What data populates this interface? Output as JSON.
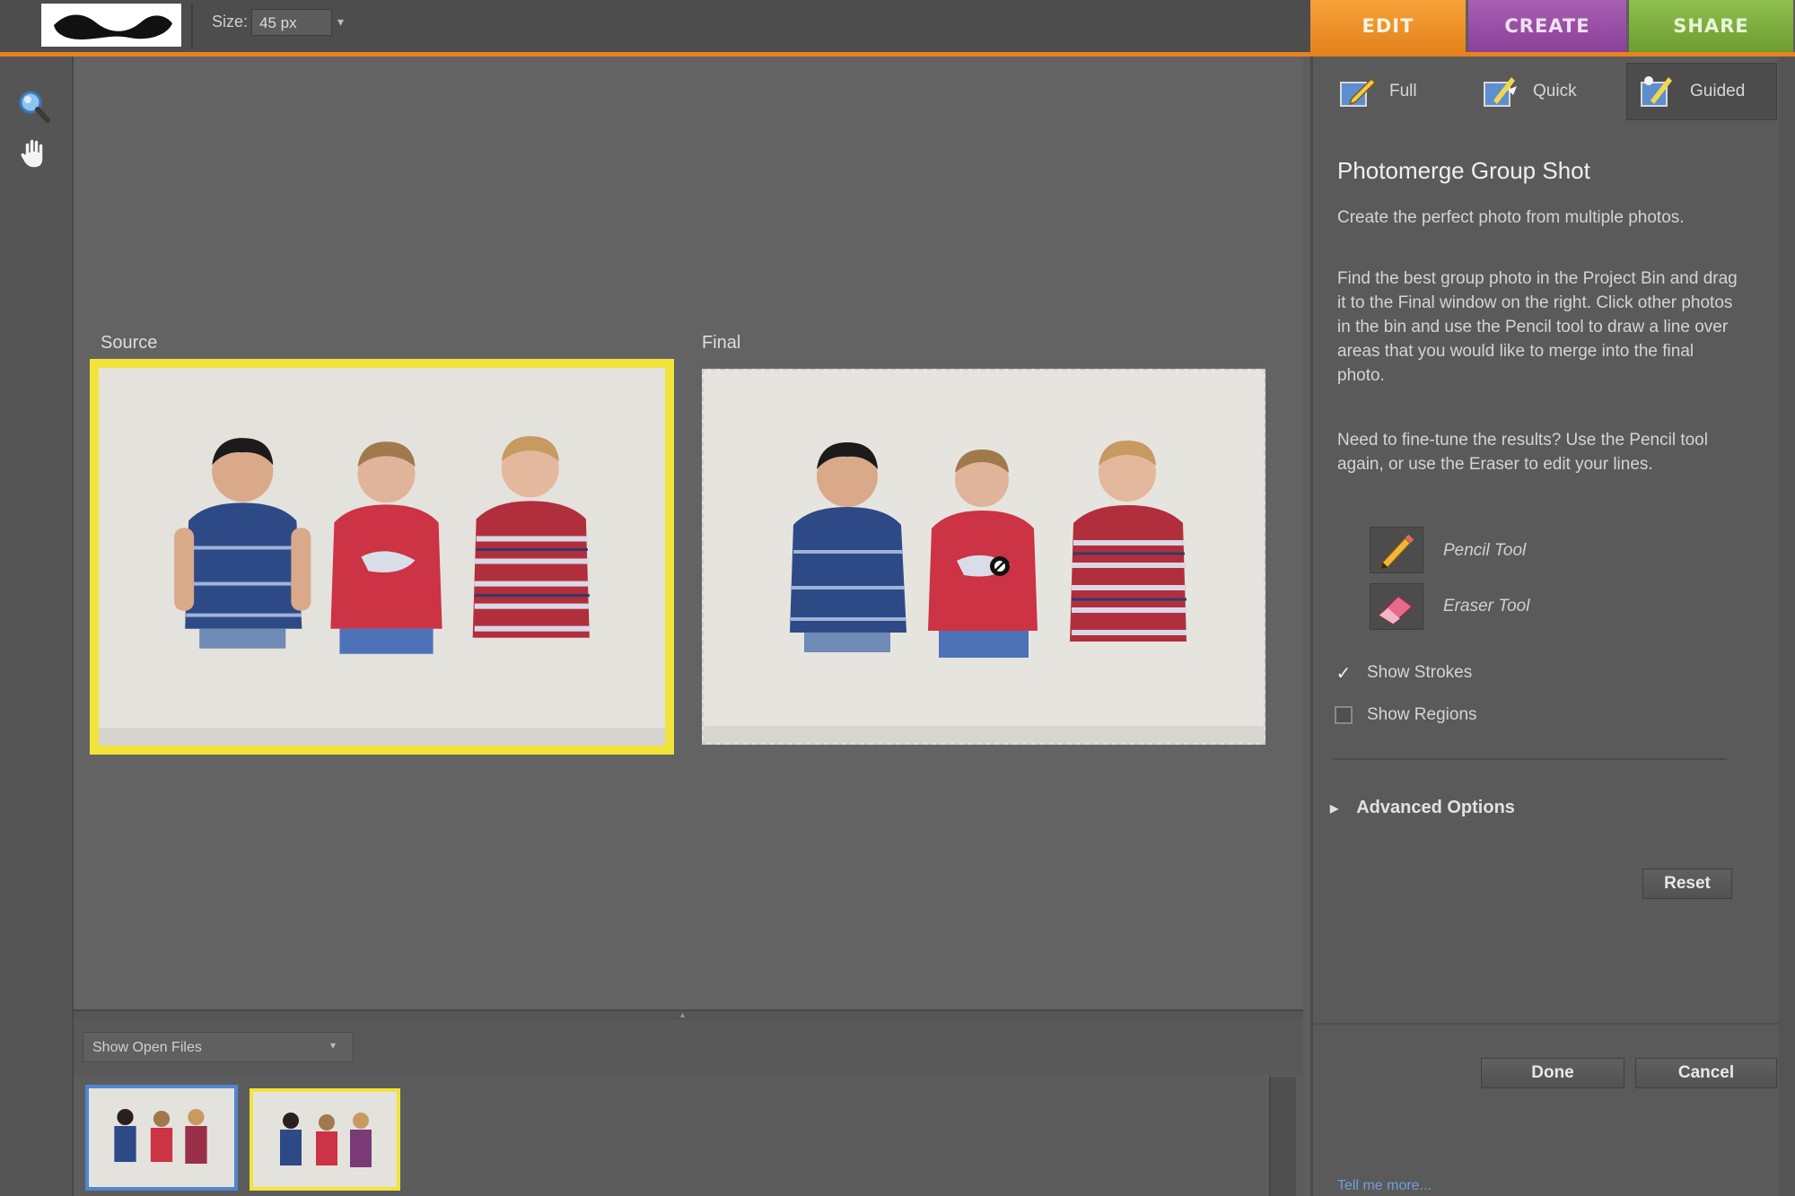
{
  "options_bar": {
    "size_label": "Size:",
    "size_value": "45 px"
  },
  "mode_tabs": [
    {
      "label": "EDIT"
    },
    {
      "label": "CREATE"
    },
    {
      "label": "SHARE"
    }
  ],
  "view_tabs": [
    {
      "label": "Full"
    },
    {
      "label": "Quick"
    },
    {
      "label": "Guided"
    }
  ],
  "canvas": {
    "source_label": "Source",
    "final_label": "Final"
  },
  "panel": {
    "title": "Photomerge Group Shot",
    "intro": "Create the perfect photo from multiple photos.",
    "instructions": "Find the best group photo in the Project Bin and drag it to the Final window on the right. Click other photos in the bin and use the Pencil tool to draw a line over areas that you would like to merge into the final photo.",
    "fine_tune": "Need to fine-tune the results? Use the Pencil tool again, or use the Eraser to edit your lines.",
    "pencil_tool": "Pencil Tool",
    "eraser_tool": "Eraser Tool",
    "show_strokes": "Show Strokes",
    "show_strokes_checked": true,
    "show_regions": "Show Regions",
    "show_regions_checked": false,
    "advanced_options": "Advanced Options",
    "reset": "Reset",
    "done": "Done",
    "cancel": "Cancel",
    "tell_me_more": "Tell me more..."
  },
  "project_bin": {
    "filter_value": "Show Open Files"
  },
  "colors": {
    "edit_tab": "#e8821e",
    "create_tab": "#9a4ca6",
    "share_tab": "#7eae40",
    "source_frame": "#f2e33a",
    "selected_thumb": "#4f86cf"
  }
}
